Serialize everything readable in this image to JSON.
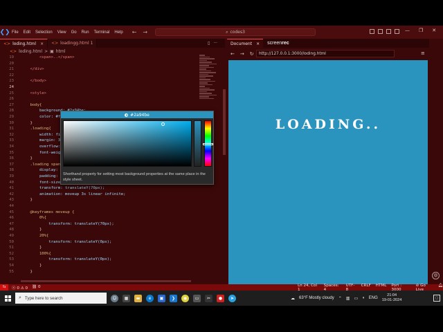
{
  "titlebar": {
    "menu": [
      "File",
      "Edit",
      "Selection",
      "View",
      "Go",
      "Run",
      "Terminal",
      "Help"
    ],
    "command_center": "codes3",
    "vscode_logo_icon": "vscode-logo-icon"
  },
  "editor_tabs": [
    {
      "label": "loding.html",
      "close": "×"
    },
    {
      "label": "loadingg.html 1",
      "close": ""
    }
  ],
  "breadcrumb": {
    "file": "loding.html",
    "sep": ">",
    "node": "html"
  },
  "code_lines": [
    {
      "n": "19",
      "text": "        <span>..</span>"
    },
    {
      "n": "20",
      "text": ""
    },
    {
      "n": "21",
      "text": "    </div>"
    },
    {
      "n": "22",
      "text": ""
    },
    {
      "n": "23",
      "text": "    </body>"
    },
    {
      "n": "24",
      "text": ""
    },
    {
      "n": "25",
      "text": "    <style>"
    },
    {
      "n": "26",
      "text": ""
    },
    {
      "n": "27",
      "text": "    body{"
    },
    {
      "n": "28",
      "text": "        background: #2a94be;"
    },
    {
      "n": "29",
      "text": "        color: #fff;"
    },
    {
      "n": "30",
      "text": "    }"
    },
    {
      "n": "31",
      "text": "    .loading{"
    },
    {
      "n": "32",
      "text": "        width: fit-content;"
    },
    {
      "n": "33",
      "text": "        margin: 30% auto;"
    },
    {
      "n": "34",
      "text": "        overflow: hidden;"
    },
    {
      "n": "35",
      "text": "        font-weight: bold;"
    },
    {
      "n": "36",
      "text": "    }"
    },
    {
      "n": "37",
      "text": "    .loading span{"
    },
    {
      "n": "38",
      "text": "        display: inline-block;"
    },
    {
      "n": "39",
      "text": "        padding: 2px;"
    },
    {
      "n": "40",
      "text": "        font-size: 50px;"
    },
    {
      "n": "41",
      "text": "        transform: translateY(70px);"
    },
    {
      "n": "42",
      "text": "        animation: moveup 3s linear infinite;"
    },
    {
      "n": "43",
      "text": "    }"
    },
    {
      "n": "44",
      "text": ""
    },
    {
      "n": "45",
      "text": "    @keyframes moveup {"
    },
    {
      "n": "46",
      "text": "        0%{"
    },
    {
      "n": "47",
      "text": "            transform: translateY(70px);"
    },
    {
      "n": "48",
      "text": "        }"
    },
    {
      "n": "49",
      "text": "        20%{"
    },
    {
      "n": "50",
      "text": "            transform: translateY(0px);"
    },
    {
      "n": "51",
      "text": "        }"
    },
    {
      "n": "52",
      "text": "        100%{"
    },
    {
      "n": "53",
      "text": "            transform: translateY(0px);"
    },
    {
      "n": "54",
      "text": "        }"
    },
    {
      "n": "55",
      "text": "    }"
    }
  ],
  "color_picker": {
    "value": "#2a94be",
    "description": "Shorthand property for setting most background properties at the same place in the style sheet."
  },
  "side_panel": {
    "tab_label": "Document",
    "tab_close": "×",
    "screenrec_prefix": "screen",
    "screenrec_suffix": "rec",
    "url": "http://127.0.0.1:3000/loding.html",
    "page_text": "LOADING.."
  },
  "statusbar": {
    "errors": "0",
    "warnings": "0",
    "ports": "0",
    "position": "Ln 24, Col 1",
    "spaces": "Spaces: 4",
    "encoding": "UTF-8",
    "eol": "CRLF",
    "language": "HTML",
    "port": "Port : 3000",
    "golive": "Go Live"
  },
  "taskbar": {
    "search_placeholder": "Type here to search",
    "weather": "63°F  Mostly cloudy",
    "lang": "ENG",
    "time": "21:04",
    "date": "19-01-2024"
  },
  "colors": {
    "accent": "#2a94be",
    "chrome": "#3a0808",
    "statusbar": "#7a0a0a"
  }
}
